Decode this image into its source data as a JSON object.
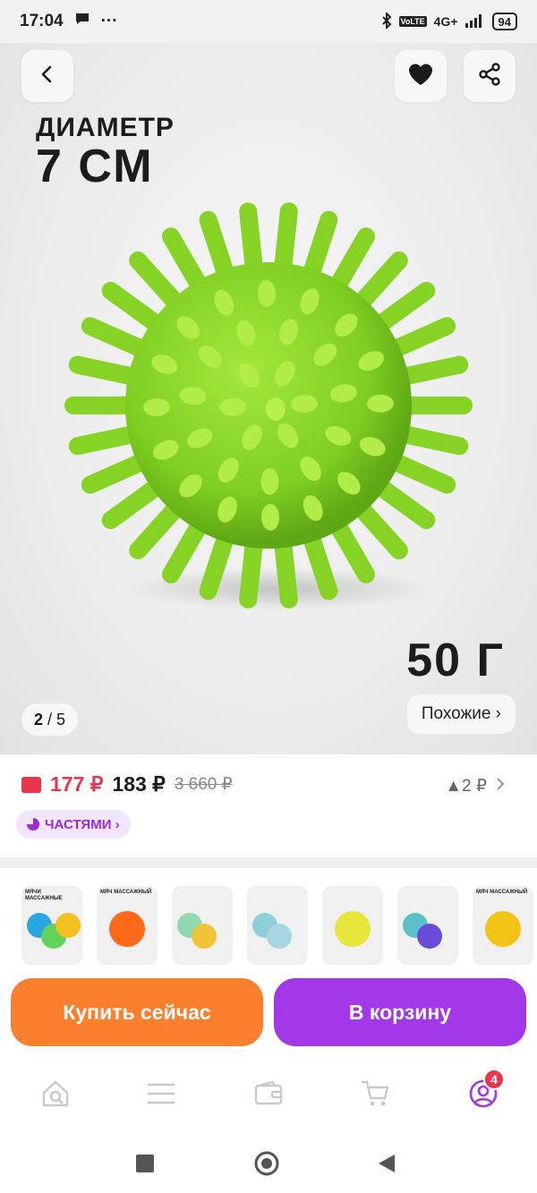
{
  "status_bar": {
    "time": "17:04",
    "network": "4G+",
    "battery": "94"
  },
  "hero": {
    "caption_line1": "ДИАМЕТР",
    "caption_line2": "7 СМ",
    "weight": "50 Г",
    "counter_current": "2",
    "counter_total": "/ 5",
    "similar_label": "Похожие ›"
  },
  "price": {
    "main": "177 ₽",
    "alt": "183 ₽",
    "old": "3 660 ₽",
    "delta": "▲2 ₽",
    "parts_label": "ЧАСТЯМИ ›"
  },
  "thumbnails": [
    {
      "title": "МЯЧИ МАССАЖНЫЕ",
      "colors": [
        "#2aa6e0",
        "#5fd35a",
        "#f4c020"
      ]
    },
    {
      "title": "МЯЧ МАССАЖНЫЙ",
      "colors": [
        "#ff6a1a"
      ]
    },
    {
      "title": "",
      "colors": [
        "#8fd8b0",
        "#f0c43a"
      ]
    },
    {
      "title": "",
      "colors": [
        "#8ccfd8",
        "#a7d6e0"
      ]
    },
    {
      "title": "",
      "colors": [
        "#e8e63a"
      ]
    },
    {
      "title": "",
      "colors": [
        "#5bc0c8",
        "#6a4ad8"
      ]
    },
    {
      "title": "МЯЧ МАССАЖНЫЙ",
      "colors": [
        "#f2c418"
      ]
    }
  ],
  "actions": {
    "buy_now": "Купить сейчас",
    "add_to_cart": "В корзину"
  },
  "bottom_nav": {
    "cart_badge": "4"
  },
  "colors": {
    "accent_purple": "#a238e8",
    "accent_orange": "#fb7f2d",
    "price_red": "#e8364f",
    "ball_green": "#8ad62a"
  }
}
